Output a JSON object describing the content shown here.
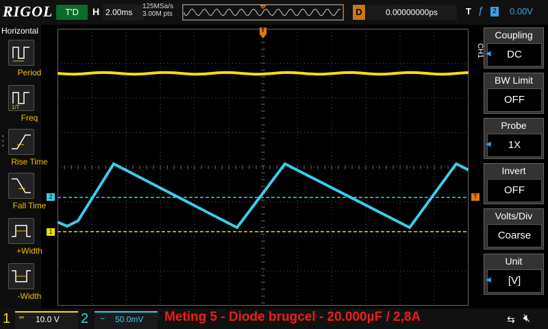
{
  "topbar": {
    "brand": "RIGOL",
    "state": "T'D",
    "h_label": "H",
    "timebase": "2.00ms",
    "sample_rate": "125MSa/s",
    "memory_depth": "3.00M pts",
    "delay_label": "D",
    "delay_value": "0.00000000ps",
    "trigger_label": "T",
    "trigger_source": "2",
    "trigger_level": "0.00V"
  },
  "leftpanel": {
    "title": "Horizontal",
    "items": [
      {
        "label": "Period",
        "icon": "period-icon"
      },
      {
        "label": "Freq",
        "icon": "freq-icon"
      },
      {
        "label": "Rise Time",
        "icon": "rise-time-icon"
      },
      {
        "label": "Fall Time",
        "icon": "fall-time-icon"
      },
      {
        "label": "+Width",
        "icon": "pos-width-icon"
      },
      {
        "label": "-Width",
        "icon": "neg-width-icon"
      }
    ]
  },
  "rightmenu": {
    "channel_tag": "CH1",
    "items": [
      {
        "title": "Coupling",
        "value": "DC"
      },
      {
        "title": "BW Limit",
        "value": "OFF"
      },
      {
        "title": "Probe",
        "value": "1X"
      },
      {
        "title": "Invert",
        "value": "OFF"
      },
      {
        "title": "Volts/Div",
        "value": "Coarse"
      },
      {
        "title": "Unit",
        "value": "[V]"
      }
    ]
  },
  "markers": {
    "trigger_top": "T",
    "ch2_marker": "2",
    "ch1_marker": "1",
    "trigger_right": "T"
  },
  "bottombar": {
    "ch1_number": "1",
    "ch1_coupling": "DC",
    "ch1_scale": "10.0 V",
    "ch2_number": "2",
    "ch2_coupling": "~",
    "ch2_scale": "50.0mV",
    "caption": "Meting 5 - Diode brugcel - 20.000µF / 2,8A"
  },
  "colors": {
    "ch1": "#f0e010",
    "ch2": "#3acfe8",
    "accent_orange": "#e07a10",
    "caption_red": "#ee1c1c"
  }
}
